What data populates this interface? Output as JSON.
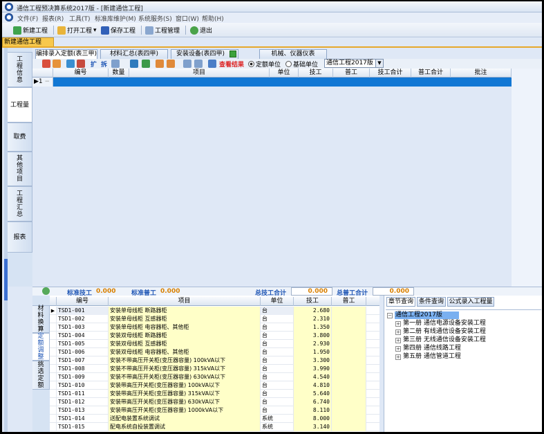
{
  "window": {
    "title": "通信工程预决算系统2017版 - [新建通信工程]"
  },
  "menu": [
    "文件(F)",
    "报表(R)",
    "工具(T)",
    "标准库维护(M)",
    "系统服务(S)",
    "窗口(W)",
    "帮助(H)"
  ],
  "toolbar": {
    "new_project": "新建工程",
    "open_project": "打开工程",
    "save_project": "保存工程",
    "project_manage": "工程管理",
    "exit": "退出"
  },
  "doc_tab": "新建通信工程",
  "left_nav": [
    "工程信息",
    "工程量",
    "取费",
    "其他项目",
    "工程汇总",
    "报表"
  ],
  "tabs": [
    "编排录入定额(表三甲)",
    "材料汇总(表四甲)",
    "安装设备(表四甲)",
    "机械、仪器仪表"
  ],
  "subtoolbar": {
    "expand": "扩",
    "split": "拆",
    "view_result": "查看结果",
    "radio_quota": "定额单位",
    "radio_base": "基础单位",
    "library_select": "通信工程2017版"
  },
  "grid": {
    "columns": [
      "编号",
      "数量",
      "项目",
      "单位",
      "技工",
      "普工",
      "技工合计",
      "普工合计",
      "批注"
    ],
    "row_label": "1"
  },
  "summary": {
    "std_tech_label": "标准技工",
    "std_tech_value": "0.000",
    "std_gen_label": "标准普工",
    "std_gen_value": "0.000",
    "total_tech_label": "总技工合计",
    "total_tech_value": "0.000",
    "total_gen_label": "总普工合计",
    "total_gen_value": "0.000"
  },
  "bottom_left": [
    "材料换算",
    "定额调整",
    "挑选定额"
  ],
  "library": {
    "columns": [
      "编号",
      "项目",
      "单位",
      "技工",
      "普工"
    ],
    "rows": [
      {
        "code": "TSD1-001",
        "name": "安装单母线柜 断路器柜",
        "unit": "台",
        "tech": "2.680"
      },
      {
        "code": "TSD1-002",
        "name": "安装单母线柜 互感器柜",
        "unit": "台",
        "tech": "2.310"
      },
      {
        "code": "TSD1-003",
        "name": "安装单母线柜 电容器柜、其他柜",
        "unit": "台",
        "tech": "1.350"
      },
      {
        "code": "TSD1-004",
        "name": "安装双母线柜 断路器柜",
        "unit": "台",
        "tech": "3.800"
      },
      {
        "code": "TSD1-005",
        "name": "安装双母线柜 互感器柜",
        "unit": "台",
        "tech": "2.930"
      },
      {
        "code": "TSD1-006",
        "name": "安装双母线柜 电容器柜、其他柜",
        "unit": "台",
        "tech": "1.950"
      },
      {
        "code": "TSD1-007",
        "name": "安装不带高压开关柜(变压器容量) 100kVA以下",
        "unit": "台",
        "tech": "3.300"
      },
      {
        "code": "TSD1-008",
        "name": "安装不带高压开关柜(变压器容量) 315kVA以下",
        "unit": "台",
        "tech": "3.990"
      },
      {
        "code": "TSD1-009",
        "name": "安装不带高压开关柜(变压器容量) 630kVA以下",
        "unit": "台",
        "tech": "4.540"
      },
      {
        "code": "TSD1-010",
        "name": "安装带高压开关柜(变压器容量) 100kVA以下",
        "unit": "台",
        "tech": "4.810"
      },
      {
        "code": "TSD1-011",
        "name": "安装带高压开关柜(变压器容量) 315kVA以下",
        "unit": "台",
        "tech": "5.640"
      },
      {
        "code": "TSD1-012",
        "name": "安装带高压开关柜(变压器容量) 630kVA以下",
        "unit": "台",
        "tech": "6.740"
      },
      {
        "code": "TSD1-013",
        "name": "安装带高压开关柜(变压器容量) 1000kVA以下",
        "unit": "台",
        "tech": "8.110"
      },
      {
        "code": "TSD1-014",
        "name": "送配电装置系统调试",
        "unit": "系统",
        "tech": "8.000"
      },
      {
        "code": "TSD1-015",
        "name": "配电系统自投装置调试",
        "unit": "系统",
        "tech": "3.140"
      }
    ]
  },
  "tree": {
    "tabs": [
      "章节查询",
      "条件查询",
      "公式录入工程量"
    ],
    "root": "通信工程2017版",
    "children": [
      "第一册 通信电源设备安装工程",
      "第二册 有线通信设备安装工程",
      "第三册 无线通信设备安装工程",
      "第四册 通信线路工程",
      "第五册 通信管道工程"
    ]
  },
  "colors": {
    "accent": "#1177d4",
    "tab_orange": "#f7c84d",
    "summary_blue": "#1f56b5",
    "summary_value": "#d98000"
  }
}
